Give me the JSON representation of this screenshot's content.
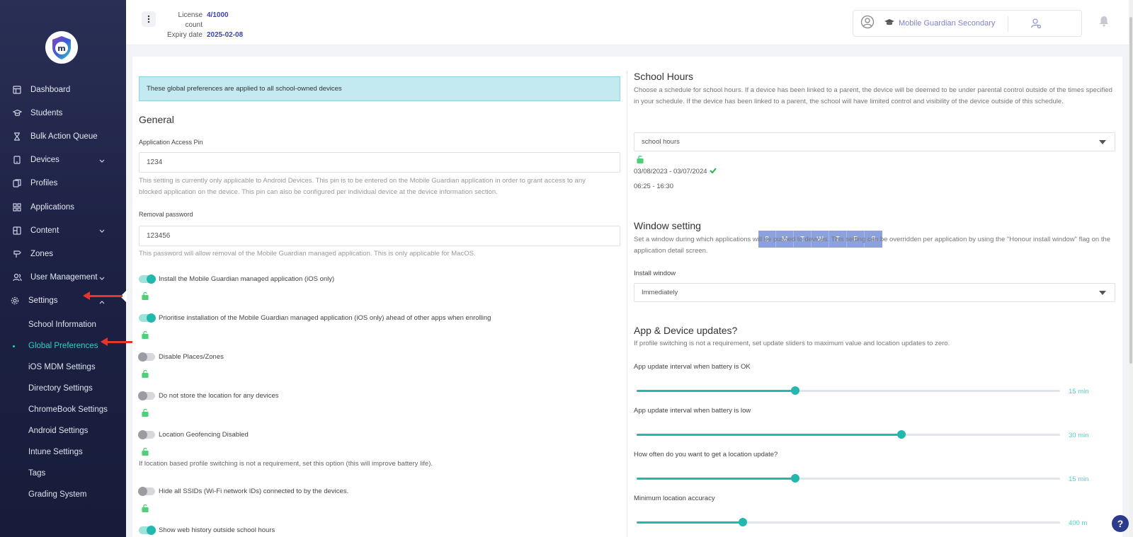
{
  "sidebar": {
    "items": [
      {
        "label": "Dashboard",
        "icon": "dashboard-icon"
      },
      {
        "label": "Students",
        "icon": "graduation-cap-icon"
      },
      {
        "label": "Bulk Action Queue",
        "icon": "hourglass-icon"
      },
      {
        "label": "Devices",
        "icon": "device-icon"
      },
      {
        "label": "Profiles",
        "icon": "profiles-icon"
      },
      {
        "label": "Applications",
        "icon": "apps-grid-icon"
      },
      {
        "label": "Content",
        "icon": "content-icon"
      },
      {
        "label": "Zones",
        "icon": "signpost-icon"
      },
      {
        "label": "User Management",
        "icon": "users-icon"
      },
      {
        "label": "Settings",
        "icon": "gear-icon"
      }
    ],
    "settings_sub": [
      "School Information",
      "Global Preferences",
      "iOS MDM Settings",
      "Directory Settings",
      "ChromeBook Settings",
      "Android Settings",
      "Intune Settings",
      "Tags",
      "Grading System"
    ],
    "active_sub": "Global Preferences"
  },
  "topbar": {
    "license_label": "License count",
    "license_value": "4/1000",
    "expiry_label": "Expiry date",
    "expiry_value": "2025-02-08",
    "user_name": "Mobile Guardian Secondary"
  },
  "left": {
    "banner": "These global preferences are applied to all school-owned devices",
    "general_title": "General",
    "pin_label": "Application Access Pin",
    "pin_value": "1234",
    "pin_help": "This setting is currently only applicable to Android Devices. This pin is to be entered on the Mobile Guardian application in order to grant access to any blocked application on the device. This pin can also be configured per individual device at the device information section.",
    "removal_label": "Removal password",
    "removal_value": "123456",
    "removal_help": "This password will allow removal of the Mobile Guardian managed application. This is only applicable for MacOS.",
    "toggles": [
      {
        "label": "Install the Mobile Guardian managed application (iOS only)",
        "on": true
      },
      {
        "label": "Prioritise installation of the Mobile Guardian managed application (iOS only) ahead of other apps when enrolling",
        "on": true
      },
      {
        "label": "Disable Places/Zones",
        "on": false
      },
      {
        "label": "Do not store the location for any devices",
        "on": false
      },
      {
        "label": "Location Geofencing Disabled",
        "on": false
      },
      {
        "label": "Hide all SSIDs (Wi-Fi network IDs) connected to by the devices.",
        "on": false
      },
      {
        "label": "Show web history outside school hours",
        "on": true
      }
    ],
    "geofence_help": "If location based profile switching is not a requirement, set this option (this will improve battery life)."
  },
  "right": {
    "school_hours_title": "School Hours",
    "school_hours_desc": "Choose a schedule for school hours. If a device has been linked to a parent, the device will be deemed to be under parental control outside of the times specified in your schedule. If the device has been linked to a parent, the school will have limited control and visibility of the device outside of this schedule.",
    "schedule_select": "school hours",
    "date_range": "03/08/2023 - 03/07/2024",
    "time_range": "06:25 - 16:30",
    "days": [
      "S",
      "M",
      "T",
      "W",
      "T",
      "F",
      "S"
    ],
    "window_title": "Window setting",
    "window_desc": "Set a window during which applications will be pushed to devices. This setting can be overridden per application by using the \"Honour install window\" flag on the application detail screen.",
    "install_window_label": "Install window",
    "install_window_value": "Immediately",
    "updates_title": "App & Device updates?",
    "updates_desc": "If profile switching is not a requirement, set update sliders to maximum value and location updates to zero.",
    "sliders": [
      {
        "label": "App update interval when battery is OK",
        "value": "15 min",
        "fraction": 0.375
      },
      {
        "label": "App update interval when battery is low",
        "value": "30 min",
        "fraction": 0.625
      },
      {
        "label": "How often do you want to get a location update?",
        "value": "15 min",
        "fraction": 0.375
      },
      {
        "label": "Minimum location accuracy",
        "value": "400 m",
        "fraction": 0.25
      }
    ]
  },
  "colors": {
    "accent": "#22b8ad",
    "sidebar_bg": "#1d2245",
    "banner_bg": "#c3eaf1",
    "arrow": "#e8352a",
    "day_chip": "#8da2dc"
  }
}
